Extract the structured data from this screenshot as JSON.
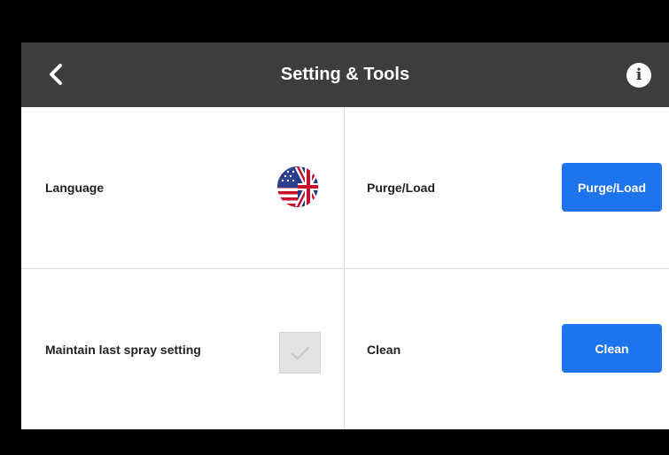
{
  "header": {
    "title": "Setting & Tools",
    "back_icon": "chevron-left-icon",
    "info_icon": "info-icon",
    "info_glyph": "i"
  },
  "settings": {
    "language": {
      "label": "Language",
      "icon": "flag-us-uk-icon"
    },
    "purge_load": {
      "label": "Purge/Load",
      "button_label": "Purge/Load"
    },
    "maintain_spray": {
      "label": "Maintain last spray setting",
      "checked": true
    },
    "clean": {
      "label": "Clean",
      "button_label": "Clean"
    }
  },
  "colors": {
    "topbar": "#3d3d3d",
    "accent": "#1e73ee",
    "divider": "#dcdcdc"
  }
}
